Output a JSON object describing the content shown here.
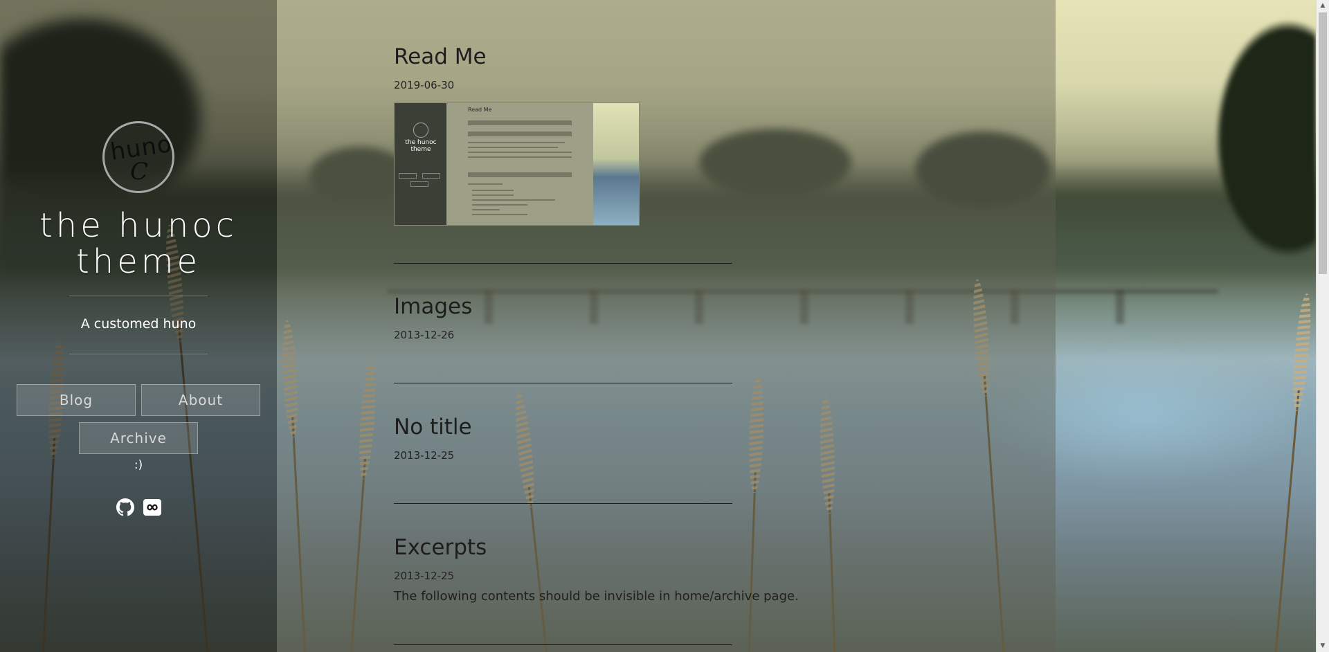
{
  "sidebar": {
    "logo_line1": "huno",
    "logo_line2": "C",
    "title_line1": "the hunoc",
    "title_line2": "theme",
    "tagline": "A customed huno",
    "nav": {
      "blog": "Blog",
      "about": "About",
      "archive": "Archive"
    },
    "smiley": ":)",
    "social_icons": [
      "github-icon",
      "infinity-icon"
    ]
  },
  "posts": [
    {
      "title": "Read Me",
      "date": "2019-06-30",
      "has_thumbnail": true
    },
    {
      "title": "Images",
      "date": "2013-12-26"
    },
    {
      "title": "No title",
      "date": "2013-12-25"
    },
    {
      "title": "Excerpts",
      "date": "2013-12-25",
      "excerpt": "The following contents should be invisible in home/archive page."
    }
  ],
  "thumbnail": {
    "mini_title": "Read Me",
    "mini_site_title": "the hunoc theme"
  },
  "colors": {
    "sidebar_overlay": "#141612",
    "content_overlay": "#5f5f50",
    "title_text": "#ffffff",
    "post_text": "#1d1d1d"
  }
}
